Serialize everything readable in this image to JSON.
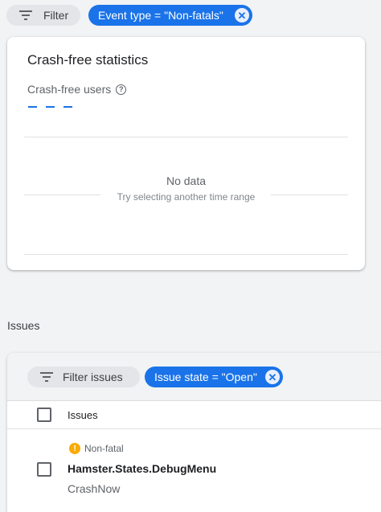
{
  "top_filters": {
    "filter_label": "Filter",
    "event_type_chip": "Event type = \"Non-fatals\""
  },
  "crash_card": {
    "title": "Crash-free statistics",
    "metric_label": "Crash-free users",
    "metric_value": "- - -",
    "no_data_title": "No data",
    "no_data_subtitle": "Try selecting another time range"
  },
  "issues": {
    "heading": "Issues",
    "filter_label": "Filter issues",
    "state_chip": "Issue state = \"Open\"",
    "column_header": "Issues",
    "rows": [
      {
        "type": "Non-fatal",
        "name": "Hamster.States.DebugMenu",
        "subtitle": "CrashNow"
      }
    ]
  },
  "colors": {
    "accent": "#1a73e8",
    "warning": "#f9ab00",
    "background": "#f1f3f4"
  }
}
